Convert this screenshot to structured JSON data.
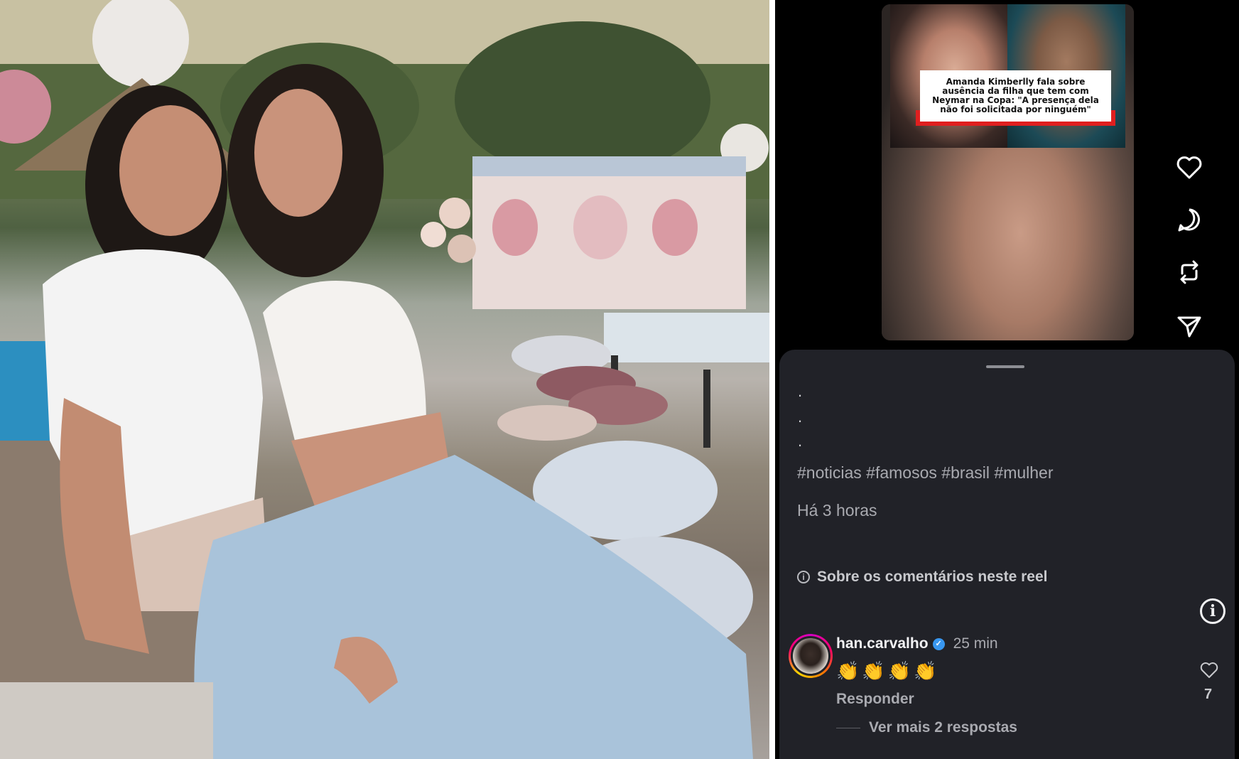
{
  "photo": {
    "icon": "party-photo"
  },
  "video": {
    "headline": "Amanda Kimberlly fala sobre ausência da filha que tem com Neymar na Copa: \"A presença dela não foi solicitada por ninguém\""
  },
  "actions": {
    "icons": [
      "heart-icon",
      "comment-icon",
      "repost-icon",
      "send-icon"
    ]
  },
  "sheet": {
    "dots": [
      ".",
      ".",
      "."
    ],
    "hashtags": "#noticias #famosos #brasil #mulher",
    "time_ago": "Há 3 horas",
    "about_comments": "Sobre os comentários neste reel",
    "about_icon": "i",
    "info_icon": "i"
  },
  "comment": {
    "username": "han.carvalho",
    "verified_mark": "✓",
    "time": "25 min",
    "body": "👏👏👏👏",
    "reply_label": "Responder",
    "like_count": "7",
    "more_replies": "Ver mais 2 respostas"
  },
  "colors": {
    "sheet_bg": "#212228",
    "verified": "#3897f0",
    "headline_accent": "#e01f1f"
  }
}
